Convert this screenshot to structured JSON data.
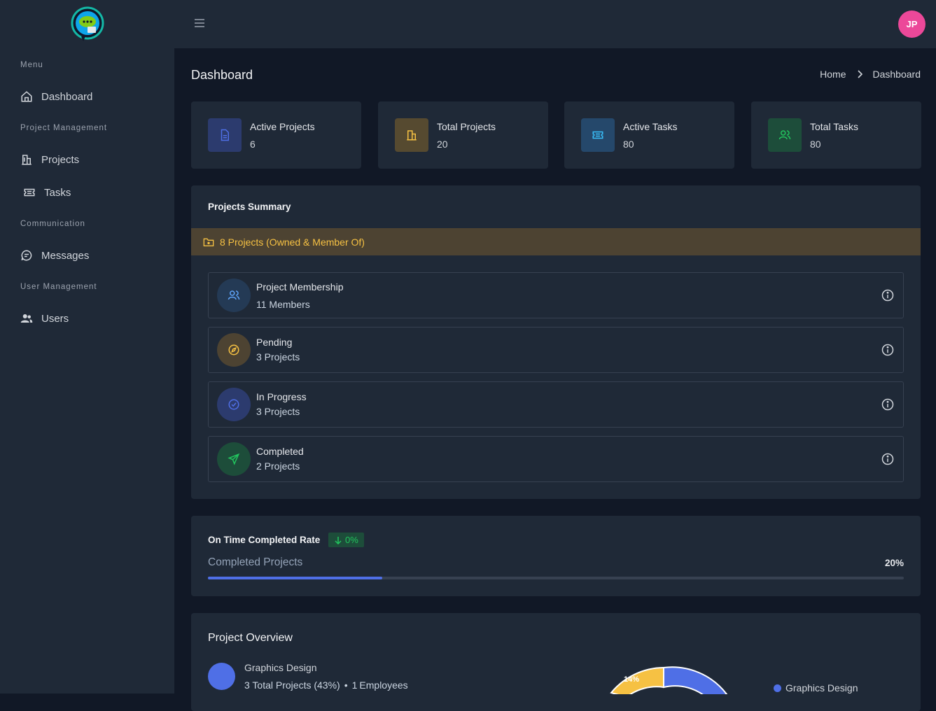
{
  "sidebar": {
    "menu_heading": "Menu",
    "items": [
      {
        "label": "Dashboard"
      },
      {
        "section": "Project Management"
      },
      {
        "label": "Projects"
      },
      {
        "label": "Tasks"
      },
      {
        "section": "Communication"
      },
      {
        "label": "Messages"
      },
      {
        "section": "User Management"
      },
      {
        "label": "Users"
      }
    ]
  },
  "topbar": {
    "avatar_initials": "JP"
  },
  "page": {
    "title": "Dashboard",
    "breadcrumb": [
      "Home",
      "Dashboard"
    ]
  },
  "stats": [
    {
      "label": "Active Projects",
      "value": "6",
      "icon": "file-icon",
      "color": "#4f6fe6"
    },
    {
      "label": "Total Projects",
      "value": "20",
      "icon": "building-icon",
      "color": "#f6c143"
    },
    {
      "label": "Active Tasks",
      "value": "80",
      "icon": "ticket-icon",
      "color": "#38bdf8"
    },
    {
      "label": "Total Tasks",
      "value": "80",
      "icon": "users-icon",
      "color": "#22c55e"
    }
  ],
  "summary": {
    "title": "Projects Summary",
    "alert": "8 Projects (Owned & Member Of)",
    "rows": [
      {
        "title": "Project Membership",
        "sub": "11 Members",
        "icon": "users-icon",
        "color": "#60a5fa"
      },
      {
        "title": "Pending",
        "sub": "3 Projects",
        "icon": "compass-icon",
        "color": "#f6c143"
      },
      {
        "title": "In Progress",
        "sub": "3 Projects",
        "icon": "check-circle-icon",
        "color": "#4f6fe6"
      },
      {
        "title": "Completed",
        "sub": "2 Projects",
        "icon": "send-icon",
        "color": "#22c55e"
      }
    ]
  },
  "rate": {
    "title": "On Time Completed Rate",
    "badge": "0%",
    "badge_icon": "arrow-down-icon",
    "progress_label": "Completed Projects",
    "progress_pct": "20%",
    "progress_value": 0.25
  },
  "overview": {
    "title": "Project Overview",
    "item_name": "Graphics Design",
    "item_projects": "3 Total Projects (43%)",
    "item_employees_count": "1",
    "item_employees_label": "Employees",
    "legend_label": "Graphics Design",
    "donut_label": "14%",
    "colors": {
      "blue": "#4f6fe6",
      "yellow": "#f6c143"
    }
  }
}
